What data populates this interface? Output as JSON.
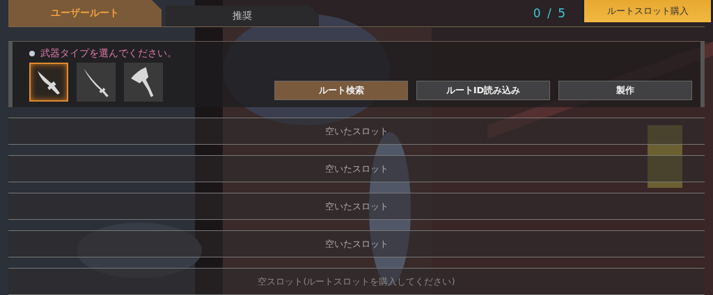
{
  "tabs": [
    {
      "label": "ユーザールート",
      "selected": true
    },
    {
      "label": "推奨",
      "selected": false
    }
  ],
  "slot_count": "0 / 5",
  "buy_button": "ルートスロット購入",
  "panel": {
    "prompt": "武器タイプを選んでください。",
    "weapons": [
      {
        "kind": "knife",
        "selected": true
      },
      {
        "kind": "sword",
        "selected": false
      },
      {
        "kind": "axe",
        "selected": false
      }
    ],
    "buttons": [
      {
        "label": "ルート検索",
        "selected": true
      },
      {
        "label": "ルートID読み込み",
        "selected": false
      },
      {
        "label": "製作",
        "selected": false
      }
    ]
  },
  "slots": [
    {
      "label": "空いたスロット",
      "kind": "open"
    },
    {
      "label": "空いたスロット",
      "kind": "open"
    },
    {
      "label": "空いたスロット",
      "kind": "open"
    },
    {
      "label": "空いたスロット",
      "kind": "open"
    },
    {
      "label": "空スロット(ルートスロットを購入してください)",
      "kind": "locked"
    }
  ]
}
